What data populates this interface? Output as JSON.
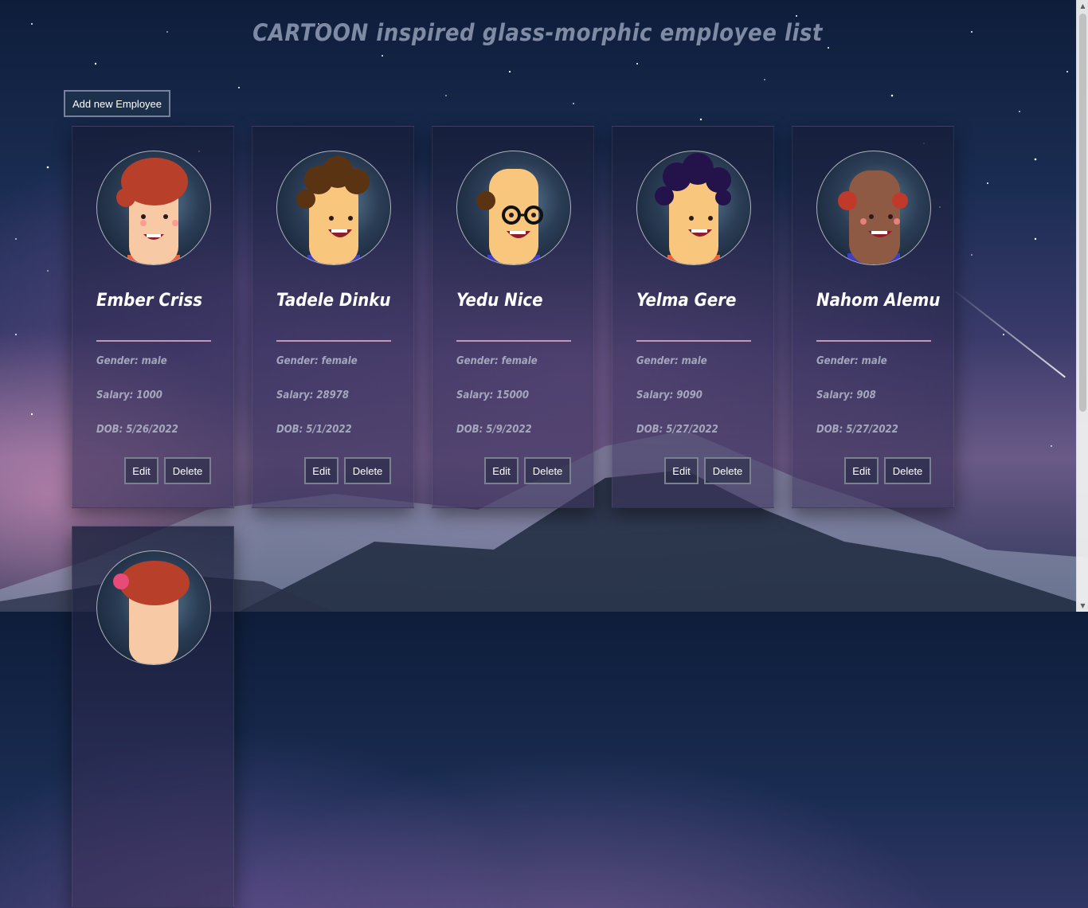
{
  "page": {
    "title": "CARTOON inspired glass-morphic employee list",
    "add_button_label": "Add new Employee"
  },
  "employees": [
    {
      "name": "Ember Criss",
      "gender": "Gender: male",
      "salary": "Salary: 1000",
      "dob": "DOB: 5/26/2022",
      "edit_label": "Edit",
      "delete_label": "Delete",
      "hair_color": "#b8402a",
      "skin_color": "#f7c9a5",
      "shirt_color": "#e4613a"
    },
    {
      "name": "Tadele Dinku",
      "gender": "Gender: female",
      "salary": "Salary: 28978",
      "dob": "DOB: 5/1/2022",
      "edit_label": "Edit",
      "delete_label": "Delete",
      "hair_color": "#5a3313",
      "skin_color": "#f8c77d",
      "shirt_color": "#3c3fc4"
    },
    {
      "name": "Yedu Nice",
      "gender": "Gender: female",
      "salary": "Salary: 15000",
      "dob": "DOB: 5/9/2022",
      "edit_label": "Edit",
      "delete_label": "Delete",
      "hair_color": "#5a3313",
      "skin_color": "#f8c77d",
      "shirt_color": "#3c3fc4"
    },
    {
      "name": "Yelma Gere",
      "gender": "Gender: male",
      "salary": "Salary: 9090",
      "dob": "DOB: 5/27/2022",
      "edit_label": "Edit",
      "delete_label": "Delete",
      "hair_color": "#24124a",
      "skin_color": "#f8c77d",
      "shirt_color": "#e4613a"
    },
    {
      "name": "Nahom Alemu",
      "gender": "Gender: male",
      "salary": "Salary: 908",
      "dob": "DOB: 5/27/2022",
      "edit_label": "Edit",
      "delete_label": "Delete",
      "hair_color": "#c0392b",
      "skin_color": "#8e5a44",
      "shirt_color": "#3c3fc4"
    },
    {
      "hair_color": "#b8402a",
      "skin_color": "#f7c9a5",
      "shirt_color": "#e4613a"
    }
  ]
}
